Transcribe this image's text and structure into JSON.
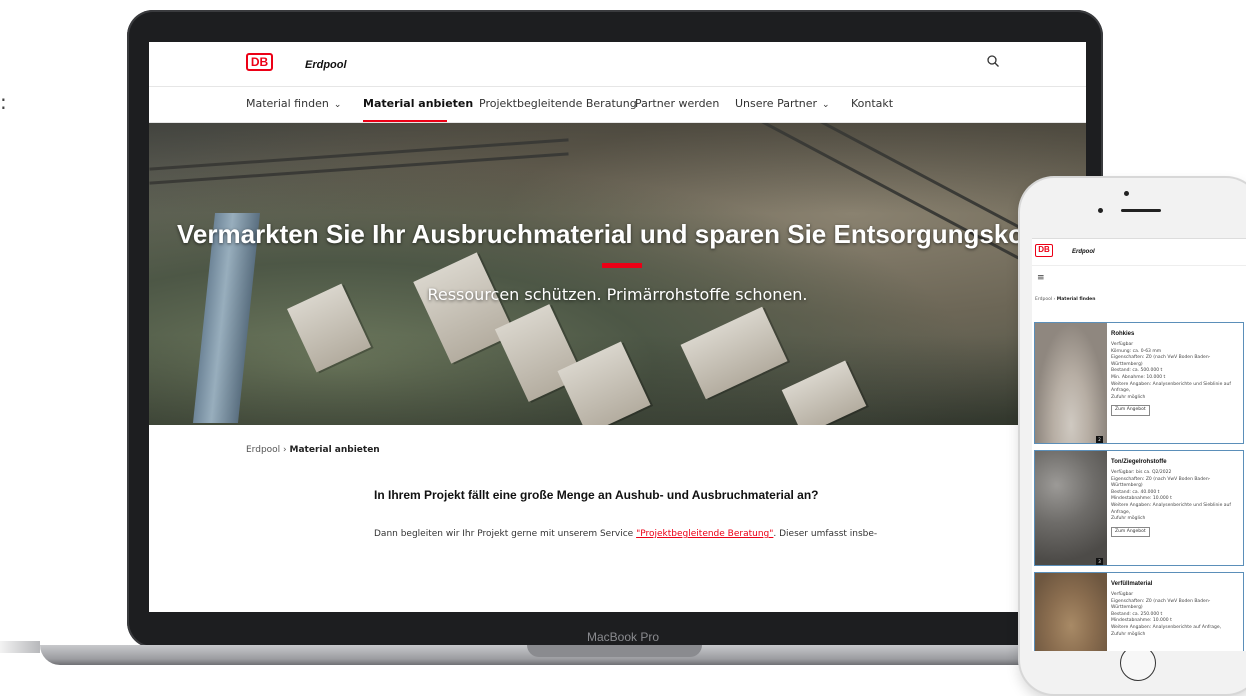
{
  "stray_char": ":",
  "device": {
    "brand_label": "MacBook Pro"
  },
  "site": {
    "logo": "DB",
    "name": "Erdpool",
    "nav": [
      {
        "label": "Material finden",
        "has_dropdown": true
      },
      {
        "label": "Material anbieten",
        "active": true
      },
      {
        "label": "Projektbegleitende Beratung"
      },
      {
        "label": "Partner werden"
      },
      {
        "label": "Unsere Partner",
        "has_dropdown": true
      },
      {
        "label": "Kontakt"
      }
    ],
    "hero": {
      "title": "Vermarkten Sie Ihr Ausbruchmaterial und sparen Sie Entsorgungskos",
      "subtitle": "Ressourcen schützen. Primärrohstoffe schonen."
    },
    "breadcrumb": {
      "home": "Erdpool",
      "separator": "›",
      "current": "Material anbieten"
    },
    "content": {
      "heading": "In Ihrem Projekt fällt eine große Menge an Aushub- und Ausbruchmaterial an?",
      "para_before": "Dann begleiten wir Ihr Projekt gerne mit unserem Service ",
      "para_link": "\"Projektbegleitende Beratung\"",
      "para_after": ". Dieser umfasst insbe-"
    },
    "accent_color": "#ec0016"
  },
  "phone": {
    "logo": "DB",
    "name": "Erdpool",
    "menu_icon": "hamburger-icon",
    "breadcrumb": {
      "home": "Erdpool",
      "separator": "›",
      "current": "Material finden"
    },
    "cards": [
      {
        "title": "Rohkies",
        "lines": [
          "Verfügbar",
          "Körnung: ca. 0-63 mm",
          "Eigenschaften: Z0 (nach VwV Boden Baden-Württemberg)",
          "Bestand: ca. 500.000 t",
          "Min. Abnahme: 10.000 t",
          "Weitere Angaben: Analysenberichte und Sieblinie auf Anfrage,",
          "Zufuhr möglich"
        ],
        "button": "Zum Angebot",
        "num": "2"
      },
      {
        "title": "Ton/Ziegelrohstoffe",
        "lines": [
          "Verfügbar: bis ca. Q2/2022",
          "Eigenschaften: Z0 (nach VwV Boden Baden-Württemberg)",
          "Bestand: ca. 40.000 t",
          "Mindestabnahme: 10.000 t",
          "Weitere Angaben: Analysenberichte und Sieblinie auf Anfrage,",
          "Zufuhr möglich"
        ],
        "button": "Zum Angebot",
        "num": "3"
      },
      {
        "title": "Verfüllmaterial",
        "lines": [
          "Verfügbar",
          "Eigenschaften: Z0 (nach VwV Boden Baden-Württemberg)",
          "Bestand: ca. 250.000 t",
          "Mindestabnahme: 10.000 t",
          "Weitere Angaben: Analysenberichte auf Anfrage,",
          "Zufuhr möglich"
        ],
        "button": "",
        "num": ""
      }
    ]
  }
}
